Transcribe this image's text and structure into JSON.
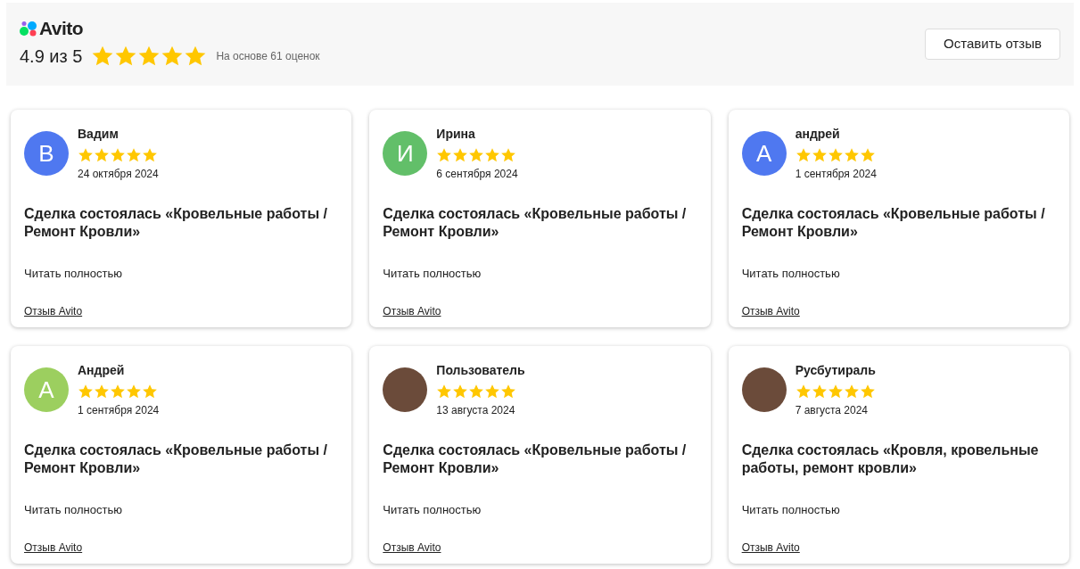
{
  "header": {
    "logo": "Avito",
    "rating": "4.9 из 5",
    "stars": 5,
    "based_on": "На основе 61 оценок",
    "button": "Оставить отзыв"
  },
  "reviews": [
    {
      "name": "Вадим",
      "avatar": {
        "kind": "letter",
        "letter": "В",
        "color": "#4f78f0"
      },
      "stars": 5,
      "date": "24 октября 2024",
      "title": "Сделка состоялась «Кровельные работы / Ремонт Кровли»",
      "read_more": "Читать полностью",
      "source": "Отзыв Avito"
    },
    {
      "name": "Ирина",
      "avatar": {
        "kind": "letter",
        "letter": "И",
        "color": "#62bf69"
      },
      "stars": 5,
      "date": "6 сентября 2024",
      "title": "Сделка состоялась «Кровельные работы / Ремонт Кровли»",
      "read_more": "Читать полностью",
      "source": "Отзыв Avito"
    },
    {
      "name": "андрей",
      "avatar": {
        "kind": "letter",
        "letter": "А",
        "color": "#4f78f0"
      },
      "stars": 5,
      "date": "1 сентября 2024",
      "title": "Сделка состоялась «Кровельные работы / Ремонт Кровли»",
      "read_more": "Читать полностью",
      "source": "Отзыв Avito"
    },
    {
      "name": "Андрей",
      "avatar": {
        "kind": "letter",
        "letter": "А",
        "color": "#9ccf5f"
      },
      "stars": 5,
      "date": "1 сентября 2024",
      "title": "Сделка состоялась «Кровельные работы / Ремонт Кровли»",
      "read_more": "Читать полностью",
      "source": "Отзыв Avito"
    },
    {
      "name": "Пользователь",
      "avatar": {
        "kind": "photo"
      },
      "stars": 5,
      "date": "13 августа 2024",
      "title": "Сделка состоялась «Кровельные работы / Ремонт Кровли»",
      "read_more": "Читать полностью",
      "source": "Отзыв Avito"
    },
    {
      "name": "Русбутираль",
      "avatar": {
        "kind": "photo"
      },
      "stars": 5,
      "date": "7 августа 2024",
      "title": "Сделка состоялась «Кровля, кровельные работы, ремонт кровли»",
      "read_more": "Читать полностью",
      "source": "Отзыв Avito"
    }
  ]
}
